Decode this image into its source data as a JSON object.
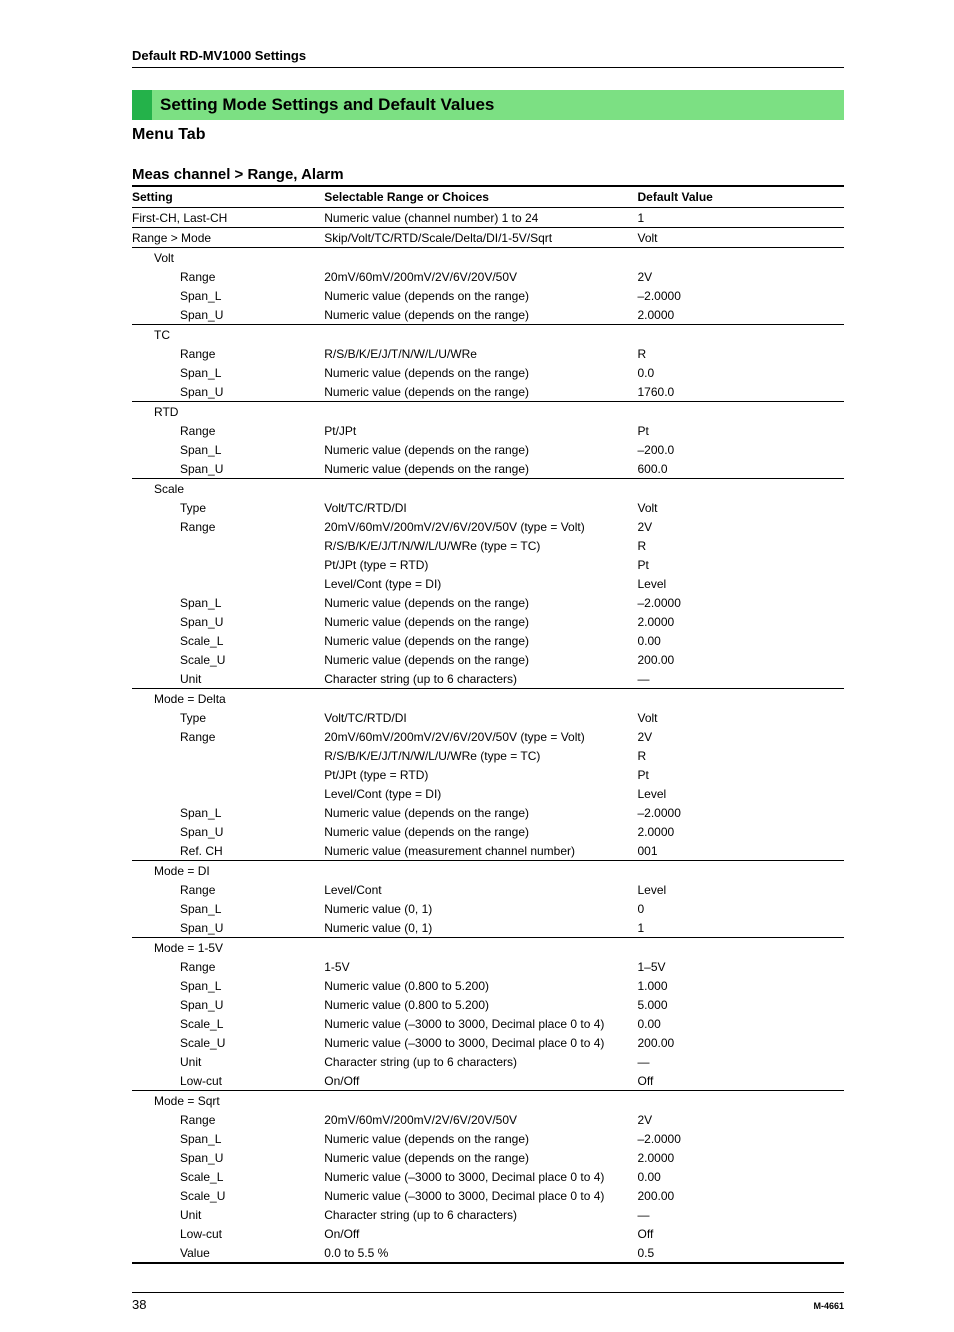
{
  "page": {
    "running_head": "Default RD-MV1000 Settings",
    "section_bar": "Setting Mode Settings and Default Values",
    "menu_tab": "Menu Tab",
    "subsection": "Meas channel > Range, Alarm",
    "page_number": "38",
    "doc_id": "M-4661"
  },
  "columns": {
    "setting": "Setting",
    "range": "Selectable Range or Choices",
    "default": "Default Value"
  },
  "rows": [
    {
      "indent": 0,
      "rule": true,
      "setting": "First-CH, Last-CH",
      "range": "Numeric value (channel number) 1 to 24",
      "default": "1"
    },
    {
      "indent": 0,
      "rule": true,
      "setting": "Range > Mode",
      "range": "Skip/Volt/TC/RTD/Scale/Delta/DI/1-5V/Sqrt",
      "default": "Volt"
    },
    {
      "indent": 1,
      "rule": false,
      "setting": "Volt",
      "range": "",
      "default": ""
    },
    {
      "indent": 2,
      "rule": false,
      "setting": "Range",
      "range": "20mV/60mV/200mV/2V/6V/20V/50V",
      "default": "2V"
    },
    {
      "indent": 2,
      "rule": false,
      "setting": "Span_L",
      "range": "Numeric value (depends on the range)",
      "default": "–2.0000"
    },
    {
      "indent": 2,
      "rule": true,
      "setting": "Span_U",
      "range": "Numeric value (depends on the range)",
      "default": "2.0000"
    },
    {
      "indent": 1,
      "rule": false,
      "setting": "TC",
      "range": "",
      "default": ""
    },
    {
      "indent": 2,
      "rule": false,
      "setting": "Range",
      "range": "R/S/B/K/E/J/T/N/W/L/U/WRe",
      "default": "R"
    },
    {
      "indent": 2,
      "rule": false,
      "setting": "Span_L",
      "range": "Numeric value (depends on the range)",
      "default": "0.0"
    },
    {
      "indent": 2,
      "rule": true,
      "setting": "Span_U",
      "range": "Numeric value (depends on the range)",
      "default": "1760.0"
    },
    {
      "indent": 1,
      "rule": false,
      "setting": "RTD",
      "range": "",
      "default": ""
    },
    {
      "indent": 2,
      "rule": false,
      "setting": "Range",
      "range": "Pt/JPt",
      "default": "Pt"
    },
    {
      "indent": 2,
      "rule": false,
      "setting": "Span_L",
      "range": "Numeric value (depends on the range)",
      "default": "–200.0"
    },
    {
      "indent": 2,
      "rule": true,
      "setting": "Span_U",
      "range": "Numeric value (depends on the range)",
      "default": "600.0"
    },
    {
      "indent": 1,
      "rule": false,
      "setting": "Scale",
      "range": "",
      "default": ""
    },
    {
      "indent": 2,
      "rule": false,
      "setting": "Type",
      "range": "Volt/TC/RTD/DI",
      "default": "Volt"
    },
    {
      "indent": 2,
      "rule": false,
      "setting": "Range",
      "range": "20mV/60mV/200mV/2V/6V/20V/50V (type = Volt)",
      "default": "2V"
    },
    {
      "indent": 2,
      "rule": false,
      "setting": "",
      "range": "R/S/B/K/E/J/T/N/W/L/U/WRe (type = TC)",
      "default": "R"
    },
    {
      "indent": 2,
      "rule": false,
      "setting": "",
      "range": "Pt/JPt (type = RTD)",
      "default": "Pt"
    },
    {
      "indent": 2,
      "rule": false,
      "setting": "",
      "range": "Level/Cont (type = DI)",
      "default": "Level"
    },
    {
      "indent": 2,
      "rule": false,
      "setting": "Span_L",
      "range": "Numeric value (depends on the range)",
      "default": "–2.0000"
    },
    {
      "indent": 2,
      "rule": false,
      "setting": "Span_U",
      "range": "Numeric value (depends on the range)",
      "default": "2.0000"
    },
    {
      "indent": 2,
      "rule": false,
      "setting": "Scale_L",
      "range": "Numeric value (depends on the range)",
      "default": "0.00"
    },
    {
      "indent": 2,
      "rule": false,
      "setting": "Scale_U",
      "range": "Numeric value (depends on the range)",
      "default": "200.00"
    },
    {
      "indent": 2,
      "rule": true,
      "setting": "Unit",
      "range": "Character string (up to 6 characters)",
      "default": "—"
    },
    {
      "indent": 1,
      "rule": false,
      "setting": "Mode = Delta",
      "range": "",
      "default": ""
    },
    {
      "indent": 2,
      "rule": false,
      "setting": "Type",
      "range": "Volt/TC/RTD/DI",
      "default": "Volt"
    },
    {
      "indent": 2,
      "rule": false,
      "setting": "Range",
      "range": "20mV/60mV/200mV/2V/6V/20V/50V (type = Volt)",
      "default": "2V"
    },
    {
      "indent": 2,
      "rule": false,
      "setting": "",
      "range": "R/S/B/K/E/J/T/N/W/L/U/WRe (type = TC)",
      "default": "R"
    },
    {
      "indent": 2,
      "rule": false,
      "setting": "",
      "range": "Pt/JPt (type = RTD)",
      "default": "Pt"
    },
    {
      "indent": 2,
      "rule": false,
      "setting": "",
      "range": "Level/Cont (type = DI)",
      "default": "Level"
    },
    {
      "indent": 2,
      "rule": false,
      "setting": "Span_L",
      "range": "Numeric value (depends on the range)",
      "default": "–2.0000"
    },
    {
      "indent": 2,
      "rule": false,
      "setting": "Span_U",
      "range": "Numeric value (depends on the range)",
      "default": "2.0000"
    },
    {
      "indent": 2,
      "rule": true,
      "setting": "Ref. CH",
      "range": "Numeric value (measurement channel number)",
      "default": "001"
    },
    {
      "indent": 1,
      "rule": false,
      "setting": "Mode = DI",
      "range": "",
      "default": ""
    },
    {
      "indent": 2,
      "rule": false,
      "setting": "Range",
      "range": "Level/Cont",
      "default": "Level"
    },
    {
      "indent": 2,
      "rule": false,
      "setting": "Span_L",
      "range": "Numeric value (0, 1)",
      "default": "0"
    },
    {
      "indent": 2,
      "rule": true,
      "setting": "Span_U",
      "range": "Numeric value (0, 1)",
      "default": "1"
    },
    {
      "indent": 1,
      "rule": false,
      "setting": "Mode = 1-5V",
      "range": "",
      "default": ""
    },
    {
      "indent": 2,
      "rule": false,
      "setting": "Range",
      "range": "1-5V",
      "default": "1–5V"
    },
    {
      "indent": 2,
      "rule": false,
      "setting": "Span_L",
      "range": "Numeric value (0.800 to 5.200)",
      "default": "1.000"
    },
    {
      "indent": 2,
      "rule": false,
      "setting": "Span_U",
      "range": "Numeric value (0.800 to 5.200)",
      "default": "5.000"
    },
    {
      "indent": 2,
      "rule": false,
      "setting": "Scale_L",
      "range": "Numeric value (–3000 to 3000, Decimal place 0 to 4)",
      "default": "0.00"
    },
    {
      "indent": 2,
      "rule": false,
      "setting": "Scale_U",
      "range": "Numeric value (–3000 to 3000, Decimal place 0 to 4)",
      "default": "200.00"
    },
    {
      "indent": 2,
      "rule": false,
      "setting": "Unit",
      "range": "Character string (up to 6 characters)",
      "default": "—"
    },
    {
      "indent": 2,
      "rule": true,
      "setting": "Low-cut",
      "range": "On/Off",
      "default": "Off"
    },
    {
      "indent": 1,
      "rule": false,
      "setting": "Mode = Sqrt",
      "range": "",
      "default": ""
    },
    {
      "indent": 2,
      "rule": false,
      "setting": "Range",
      "range": "20mV/60mV/200mV/2V/6V/20V/50V",
      "default": "2V"
    },
    {
      "indent": 2,
      "rule": false,
      "setting": "Span_L",
      "range": "Numeric value (depends on the range)",
      "default": "–2.0000"
    },
    {
      "indent": 2,
      "rule": false,
      "setting": "Span_U",
      "range": "Numeric value (depends on the range)",
      "default": "2.0000"
    },
    {
      "indent": 2,
      "rule": false,
      "setting": "Scale_L",
      "range": "Numeric value (–3000 to 3000, Decimal place 0 to 4)",
      "default": "0.00"
    },
    {
      "indent": 2,
      "rule": false,
      "setting": "Scale_U",
      "range": "Numeric value (–3000 to 3000, Decimal place 0 to 4)",
      "default": "200.00"
    },
    {
      "indent": 2,
      "rule": false,
      "setting": "Unit",
      "range": "Character string (up to 6 characters)",
      "default": "—"
    },
    {
      "indent": 2,
      "rule": false,
      "setting": "Low-cut",
      "range": "On/Off",
      "default": "Off"
    },
    {
      "indent": 2,
      "rule": false,
      "setting": "Value",
      "range": "0.0 to 5.5 %",
      "default": "0.5"
    }
  ]
}
